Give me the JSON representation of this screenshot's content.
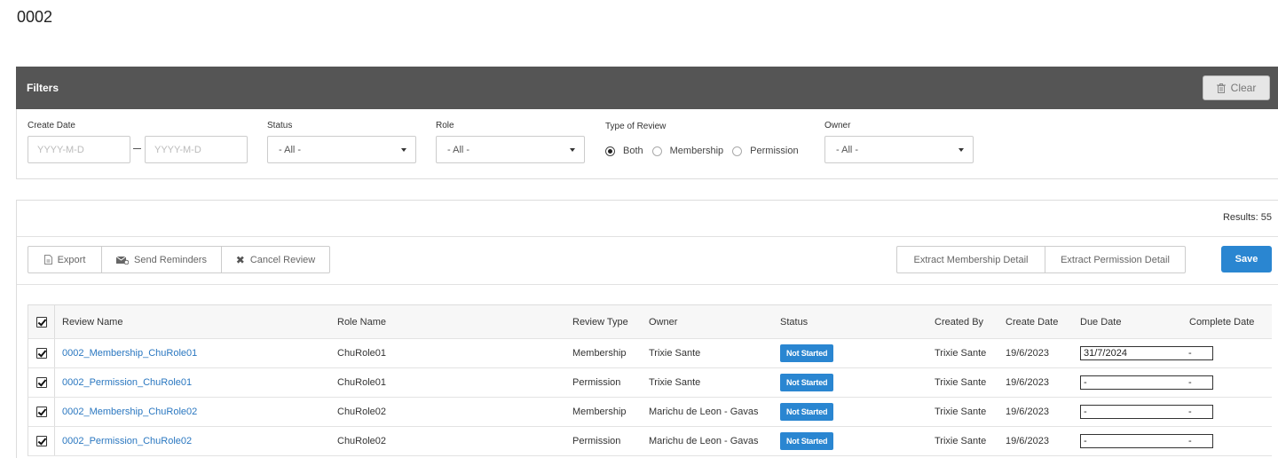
{
  "page": {
    "title": "0002"
  },
  "filters": {
    "title": "Filters",
    "clear_label": "Clear",
    "create_date_label": "Create Date",
    "from_placeholder": "YYYY-M-D",
    "to_placeholder": "YYYY-M-D",
    "status_label": "Status",
    "status_value": "- All -",
    "role_label": "Role",
    "role_value": "- All -",
    "type_label": "Type of Review",
    "type_options": [
      "Both",
      "Membership",
      "Permission"
    ],
    "type_selected": "Both",
    "owner_label": "Owner",
    "owner_value": "- All -"
  },
  "results": {
    "count_text": "Results: 55",
    "export_label": "Export",
    "send_reminders_label": "Send Reminders",
    "cancel_review_label": "Cancel Review",
    "extract_membership_label": "Extract Membership Detail",
    "extract_permission_label": "Extract Permission Detail",
    "save_label": "Save"
  },
  "table": {
    "columns": [
      "Review Name",
      "Role Name",
      "Review Type",
      "Owner",
      "Status",
      "Created By",
      "Create Date",
      "Due Date",
      "Complete Date"
    ],
    "rows": [
      {
        "review_name": "0002_Membership_ChuRole01",
        "role_name": "ChuRole01",
        "review_type": "Membership",
        "owner": "Trixie Sante",
        "status": "Not Started",
        "created_by": "Trixie Sante",
        "create_date": "19/6/2023",
        "due_date": "31/7/2024",
        "complete_date": "-"
      },
      {
        "review_name": "0002_Permission_ChuRole01",
        "role_name": "ChuRole01",
        "review_type": "Permission",
        "owner": "Trixie Sante",
        "status": "Not Started",
        "created_by": "Trixie Sante",
        "create_date": "19/6/2023",
        "due_date": "-",
        "complete_date": "-"
      },
      {
        "review_name": "0002_Membership_ChuRole02",
        "role_name": "ChuRole02",
        "review_type": "Membership",
        "owner": "Marichu de Leon - Gavas",
        "status": "Not Started",
        "created_by": "Trixie Sante",
        "create_date": "19/6/2023",
        "due_date": "-",
        "complete_date": "-"
      },
      {
        "review_name": "0002_Permission_ChuRole02",
        "role_name": "ChuRole02",
        "review_type": "Permission",
        "owner": "Marichu de Leon - Gavas",
        "status": "Not Started",
        "created_by": "Trixie Sante",
        "create_date": "19/6/2023",
        "due_date": "-",
        "complete_date": "-"
      }
    ]
  },
  "colors": {
    "accent": "#2a86d1",
    "filter_bar": "#555555",
    "link": "#2a77c0"
  },
  "icons": {
    "clear": "trash-icon",
    "export": "file-icon",
    "send": "envelope-icon",
    "cancel": "x-icon"
  }
}
